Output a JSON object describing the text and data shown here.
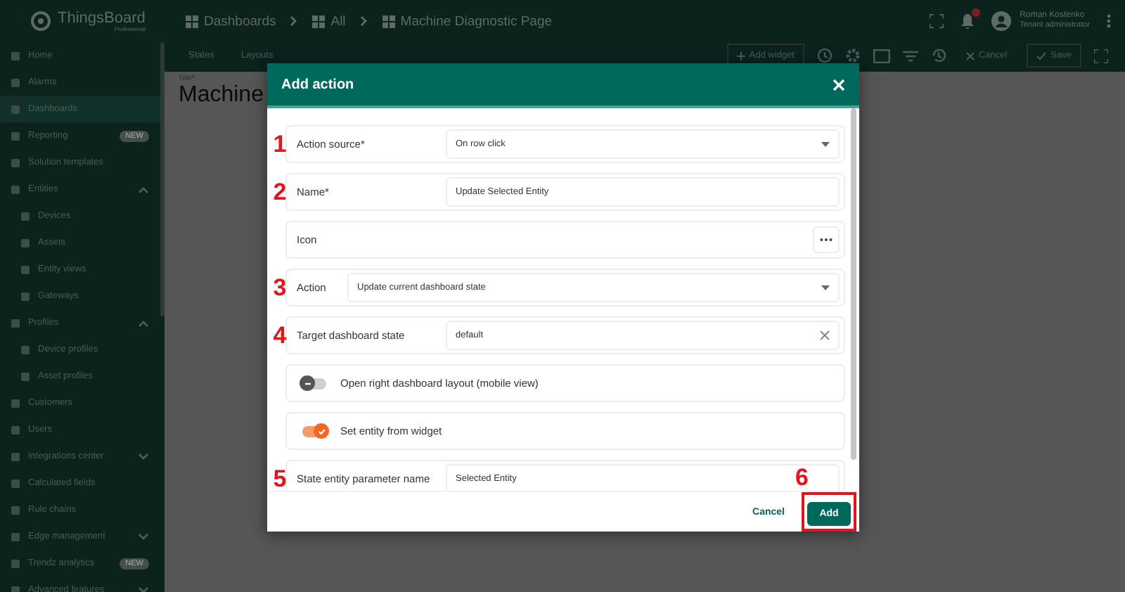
{
  "header": {
    "logo": {
      "name": "ThingsBoard",
      "subtitle": "Professional"
    },
    "breadcrumbs": [
      "Dashboards",
      "All",
      "Machine Diagnostic Page"
    ],
    "user": {
      "name": "Roman Kostenko",
      "role": "Tenant administrator"
    }
  },
  "toolbar": {
    "states": "States",
    "layouts": "Layouts",
    "add_widget": "Add widget",
    "cancel": "Cancel",
    "save": "Save"
  },
  "content": {
    "title_label": "Title*",
    "title": "Machine"
  },
  "sidebar": {
    "items": [
      {
        "label": "Home",
        "selected": false
      },
      {
        "label": "Alarms",
        "selected": false
      },
      {
        "label": "Dashboards",
        "selected": true
      },
      {
        "label": "Reporting",
        "selected": false,
        "badge": "NEW"
      },
      {
        "label": "Solution templates",
        "selected": false
      },
      {
        "label": "Entities",
        "selected": false,
        "expanded": true,
        "children": [
          {
            "label": "Devices",
            "selected": false
          },
          {
            "label": "Assets",
            "selected": false
          },
          {
            "label": "Entity views",
            "selected": false
          },
          {
            "label": "Gateways",
            "selected": false
          }
        ]
      },
      {
        "label": "Profiles",
        "selected": false,
        "expanded": true,
        "children": [
          {
            "label": "Device profiles",
            "selected": false
          },
          {
            "label": "Asset profiles",
            "selected": false
          }
        ]
      },
      {
        "label": "Customers",
        "selected": false
      },
      {
        "label": "Users",
        "selected": false
      },
      {
        "label": "Integrations center",
        "selected": false,
        "expanded": false
      },
      {
        "label": "Calculated fields",
        "selected": false
      },
      {
        "label": "Rule chains",
        "selected": false
      },
      {
        "label": "Edge management",
        "selected": false,
        "expanded": false
      },
      {
        "label": "Trendz analytics",
        "selected": false,
        "badge": "NEW"
      },
      {
        "label": "Advanced features",
        "selected": false,
        "expanded": false
      }
    ]
  },
  "dialog": {
    "title": "Add action",
    "fields": [
      {
        "kind": "select",
        "marker": "1",
        "label": "Action source*",
        "value": "On row click"
      },
      {
        "kind": "input",
        "marker": "2",
        "label": "Name*",
        "value": "Update Selected Entity"
      },
      {
        "kind": "icon",
        "label": "Icon"
      },
      {
        "kind": "select",
        "marker": "3",
        "label": "Action",
        "value": "Update current dashboard state"
      },
      {
        "kind": "clearable",
        "marker": "4",
        "label": "Target dashboard state",
        "value": "default"
      },
      {
        "kind": "toggle",
        "label": "Open right dashboard layout (mobile view)",
        "on": false
      },
      {
        "kind": "toggle",
        "label": "Set entity from widget",
        "on": true
      },
      {
        "kind": "input",
        "marker": "5",
        "label": "State entity parameter name",
        "value": "Selected Entity"
      }
    ],
    "cancel": "Cancel",
    "add": "Add",
    "add_marker": "6"
  }
}
